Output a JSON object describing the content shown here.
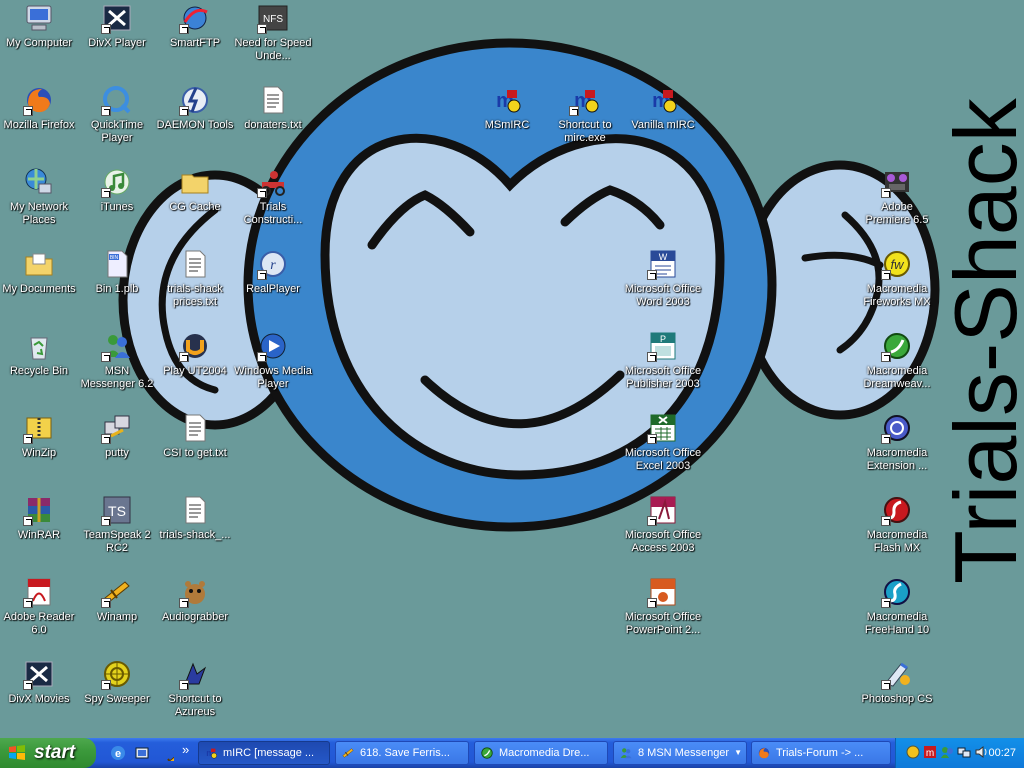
{
  "desktop": {
    "brand_text": "Trials-Shack",
    "icons": [
      {
        "label": "My Computer",
        "icon": "computer-icon",
        "shortcut": false
      },
      {
        "label": "DivX Player",
        "icon": "divx-icon",
        "shortcut": true
      },
      {
        "label": "SmartFTP",
        "icon": "smartftp-icon",
        "shortcut": true
      },
      {
        "label": "Need for Speed Unde...",
        "icon": "nfs-icon",
        "shortcut": true
      },
      {
        "label": "Mozilla Firefox",
        "icon": "firefox-icon",
        "shortcut": true
      },
      {
        "label": "QuickTime Player",
        "icon": "quicktime-icon",
        "shortcut": true
      },
      {
        "label": "DAEMON Tools",
        "icon": "daemon-tools-icon",
        "shortcut": true
      },
      {
        "label": "donaters.txt",
        "icon": "text-file-icon",
        "shortcut": false
      },
      {
        "label": "My Network Places",
        "icon": "network-icon",
        "shortcut": false
      },
      {
        "label": "iTunes",
        "icon": "itunes-icon",
        "shortcut": true
      },
      {
        "label": "CG Cache",
        "icon": "folder-icon",
        "shortcut": false
      },
      {
        "label": "Trials Constructi...",
        "icon": "trials-icon",
        "shortcut": true
      },
      {
        "label": "My Documents",
        "icon": "documents-folder-icon",
        "shortcut": false
      },
      {
        "label": "Bin 1.plb",
        "icon": "bin-file-icon",
        "shortcut": false
      },
      {
        "label": "trials-shack prices.txt",
        "icon": "text-file-icon",
        "shortcut": false
      },
      {
        "label": "RealPlayer",
        "icon": "realplayer-icon",
        "shortcut": true
      },
      {
        "label": "Recycle Bin",
        "icon": "recycle-bin-icon",
        "shortcut": false
      },
      {
        "label": "MSN Messenger 6.2",
        "icon": "msn-icon",
        "shortcut": true
      },
      {
        "label": "Play UT2004",
        "icon": "ut2004-icon",
        "shortcut": true
      },
      {
        "label": "Windows Media Player",
        "icon": "media-player-icon",
        "shortcut": true
      },
      {
        "label": "WinZip",
        "icon": "winzip-icon",
        "shortcut": true
      },
      {
        "label": "putty",
        "icon": "putty-icon",
        "shortcut": true
      },
      {
        "label": "CSI to get.txt",
        "icon": "text-file-icon",
        "shortcut": false
      },
      {
        "label": "WinRAR",
        "icon": "winrar-icon",
        "shortcut": true
      },
      {
        "label": "TeamSpeak 2 RC2",
        "icon": "teamspeak-icon",
        "shortcut": true
      },
      {
        "label": "trials-shack_...",
        "icon": "text-file-icon",
        "shortcut": false
      },
      {
        "label": "Adobe Reader 6.0",
        "icon": "adobe-reader-icon",
        "shortcut": true
      },
      {
        "label": "Winamp",
        "icon": "winamp-icon",
        "shortcut": true
      },
      {
        "label": "Audiograbber",
        "icon": "audiograbber-icon",
        "shortcut": true
      },
      {
        "label": "DivX Movies",
        "icon": "divx-icon",
        "shortcut": true
      },
      {
        "label": "Spy Sweeper",
        "icon": "spy-sweeper-icon",
        "shortcut": true
      },
      {
        "label": "Shortcut to Azureus",
        "icon": "azureus-icon",
        "shortcut": true
      },
      {
        "label": "MSmIRC",
        "icon": "mirc-icon",
        "shortcut": false
      },
      {
        "label": "Shortcut to mirc.exe",
        "icon": "mirc-icon",
        "shortcut": true
      },
      {
        "label": "Vanilla mIRC",
        "icon": "mirc-icon",
        "shortcut": false
      },
      {
        "label": "Microsoft Office Word 2003",
        "icon": "word-icon",
        "shortcut": true
      },
      {
        "label": "Microsoft Office Publisher 2003",
        "icon": "publisher-icon",
        "shortcut": true
      },
      {
        "label": "Microsoft Office Excel 2003",
        "icon": "excel-icon",
        "shortcut": true
      },
      {
        "label": "Microsoft Office Access 2003",
        "icon": "access-icon",
        "shortcut": true
      },
      {
        "label": "Microsoft Office PowerPoint 2...",
        "icon": "powerpoint-icon",
        "shortcut": true
      },
      {
        "label": "Adobe Premiere 6.5",
        "icon": "premiere-icon",
        "shortcut": true
      },
      {
        "label": "Macromedia Fireworks MX",
        "icon": "fireworks-icon",
        "shortcut": true
      },
      {
        "label": "Macromedia Dreamweav...",
        "icon": "dreamweaver-icon",
        "shortcut": true
      },
      {
        "label": "Macromedia Extension ...",
        "icon": "extension-manager-icon",
        "shortcut": true
      },
      {
        "label": "Macromedia Flash MX",
        "icon": "flash-icon",
        "shortcut": true
      },
      {
        "label": "Macromedia FreeHand 10",
        "icon": "freehand-icon",
        "shortcut": true
      },
      {
        "label": "Photoshop CS",
        "icon": "photoshop-icon",
        "shortcut": true
      }
    ]
  },
  "taskbar": {
    "start_label": "start",
    "quick_launch": [
      "ie-icon",
      "desktop-icon",
      "winamp-icon"
    ],
    "overflow": "»",
    "tasks": [
      {
        "label": "mIRC [message ...",
        "icon": "mirc-icon",
        "active": true
      },
      {
        "label": "618. Save Ferris...",
        "icon": "winamp-icon",
        "active": false
      },
      {
        "label": "Macromedia Dre...",
        "icon": "dreamweaver-icon",
        "active": false
      },
      {
        "label": "8 MSN Messenger",
        "icon": "msn-icon",
        "active": false,
        "dropdown": true
      },
      {
        "label": "Trials-Forum -> ...",
        "icon": "firefox-icon",
        "active": false
      }
    ],
    "tray_icons": [
      "norton-icon",
      "mirc-tray-icon",
      "msn-tray-icon",
      "network-tray-icon",
      "volume-icon"
    ],
    "clock": "00:27"
  }
}
